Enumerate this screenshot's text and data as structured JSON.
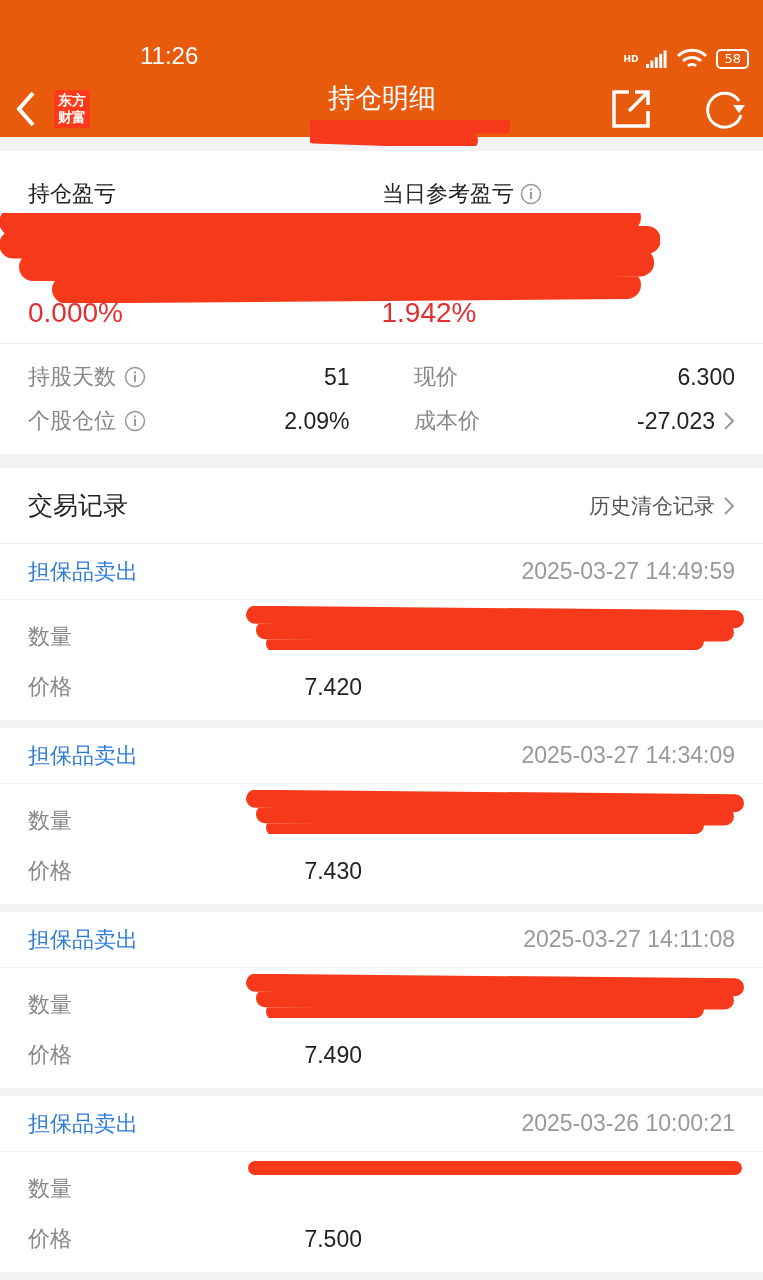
{
  "status_bar": {
    "time": "11:26",
    "network": "HD",
    "battery": "58"
  },
  "nav": {
    "logo_lines": [
      "东方",
      "财富"
    ],
    "title": "持仓明细",
    "subtitle_redacted": true
  },
  "summary": {
    "values_redacted": true,
    "columns": [
      {
        "label": "持仓盈亏",
        "info": false,
        "percent": "0.000%"
      },
      {
        "label": "当日参考盈亏",
        "info": true,
        "percent": "1.942%"
      }
    ],
    "stats": [
      {
        "label": "持股天数",
        "info": true,
        "value": "51",
        "link": false
      },
      {
        "label": "现价",
        "info": false,
        "value": "6.300",
        "link": false
      },
      {
        "label": "个股仓位",
        "info": true,
        "value": "2.09%",
        "link": false
      },
      {
        "label": "成本价",
        "info": false,
        "value": "-27.023",
        "link": true
      }
    ]
  },
  "trades": {
    "title": "交易记录",
    "history_link": "历史清仓记录",
    "records": [
      {
        "type": "担保品卖出",
        "time": "2025-03-27 14:49:59",
        "quantity_label": "数量",
        "quantity_redacted": true,
        "price_label": "价格",
        "price": "7.420"
      },
      {
        "type": "担保品卖出",
        "time": "2025-03-27 14:34:09",
        "quantity_label": "数量",
        "quantity_redacted": true,
        "price_label": "价格",
        "price": "7.430"
      },
      {
        "type": "担保品卖出",
        "time": "2025-03-27 14:11:08",
        "quantity_label": "数量",
        "quantity_redacted": true,
        "price_label": "价格",
        "price": "7.490"
      },
      {
        "type": "担保品卖出",
        "time": "2025-03-26 10:00:21",
        "quantity_label": "数量",
        "quantity_redacted": true,
        "price_label": "价格",
        "price": "7.500"
      }
    ]
  }
}
